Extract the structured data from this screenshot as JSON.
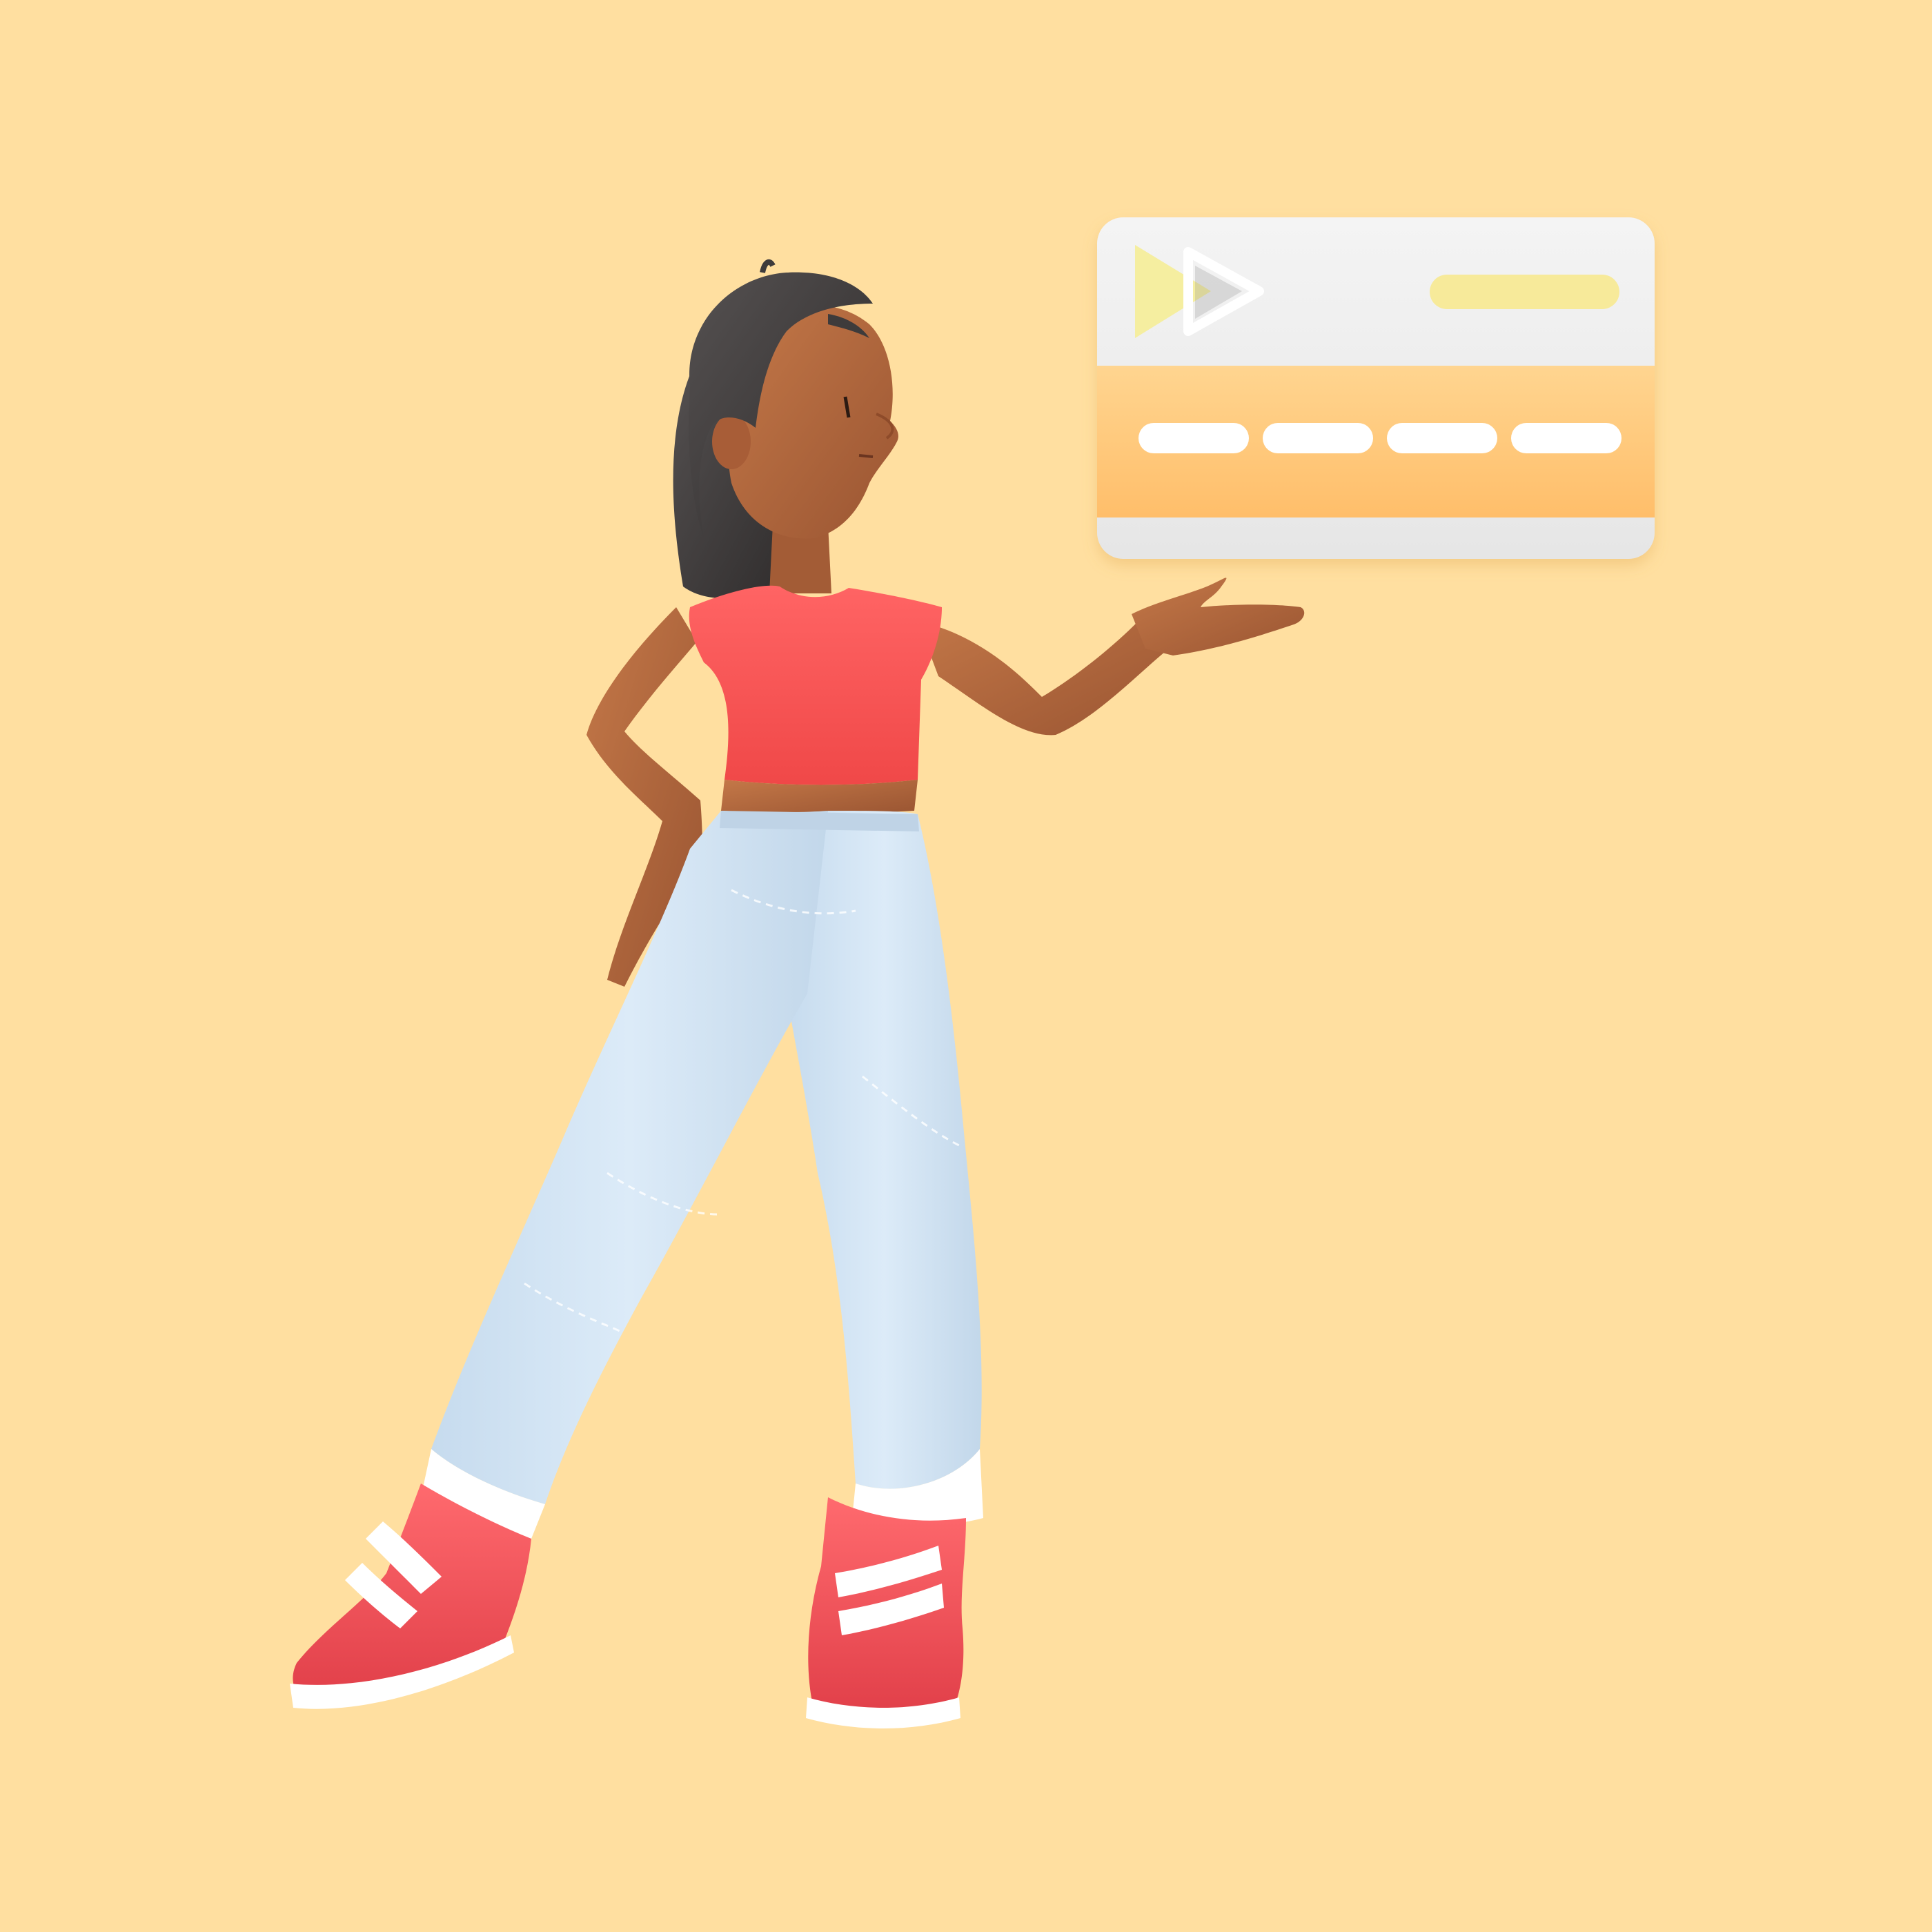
{
  "scene": {
    "background_color": "#FFDFA0",
    "subject": "woman-presenting-credit-card",
    "colors": {
      "skin": "#B5683F",
      "skin_shadow": "#8E4B2A",
      "hair": "#3E3B3B",
      "top": "#FF5A5A",
      "pants": "#CFE4F5",
      "pants_stitch": "#FFFFFF",
      "shoes": "#F24D55",
      "shoe_sole": "#FFFFFF",
      "sock": "#FFFFFF"
    }
  },
  "card": {
    "body_color": "#EFEFEF",
    "stripe_color": "#FFC872",
    "chip_label_color": "#F7EA9A",
    "play_icon_primary": "#F5EEA0",
    "play_icon_outline": "#FFFFFF",
    "number_groups": 4,
    "dash_color": "#FFFFFF"
  }
}
